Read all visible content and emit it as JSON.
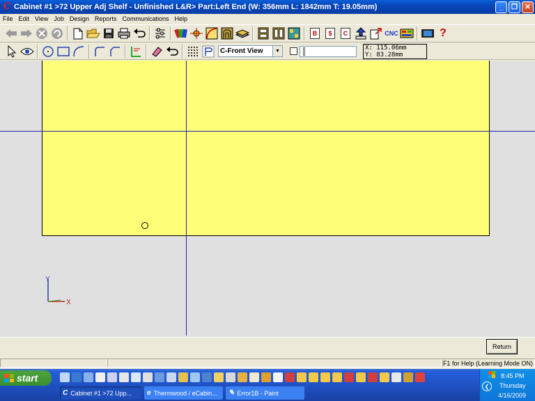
{
  "window": {
    "title": "Cabinet #1 >72 Upper Adj Shelf - Unfinished L&R> Part:Left End (W: 356mm L: 1842mm T: 19.05mm)",
    "minimize_glyph": "_",
    "restore_glyph": "❐",
    "close_glyph": "✕"
  },
  "menu": [
    "File",
    "Edit",
    "View",
    "Job",
    "Design",
    "Reports",
    "Communications",
    "Help"
  ],
  "toolbar_main": {
    "cnc_label": "CNC",
    "letters": [
      "B",
      "$",
      "C"
    ],
    "help_glyph": "?"
  },
  "toolbar_draw": {
    "view_selected": "C-Front View",
    "coord_x": "X: 115.06mm",
    "coord_y": "Y: 83.28mm"
  },
  "canvas": {
    "axis_x_label": "X",
    "axis_y_label": "Y",
    "part_color": "#ffff78",
    "guide_color": "#2222aa"
  },
  "bottom": {
    "return_label": "Return",
    "status_help": "F1 for Help (Learning Mode ON)"
  },
  "taskbar": {
    "start_label": "start",
    "tasks": [
      {
        "label": "Cabinet #1 >72 Upp...",
        "icon": "C",
        "active": true
      },
      {
        "label": "Thermwood / eCabin...",
        "icon": "e",
        "active": false
      },
      {
        "label": "Error1B - Paint",
        "icon": "✎",
        "active": false
      }
    ],
    "clock_time": "8:45 PM",
    "clock_day": "Thursday",
    "clock_date": "4/16/2009"
  }
}
